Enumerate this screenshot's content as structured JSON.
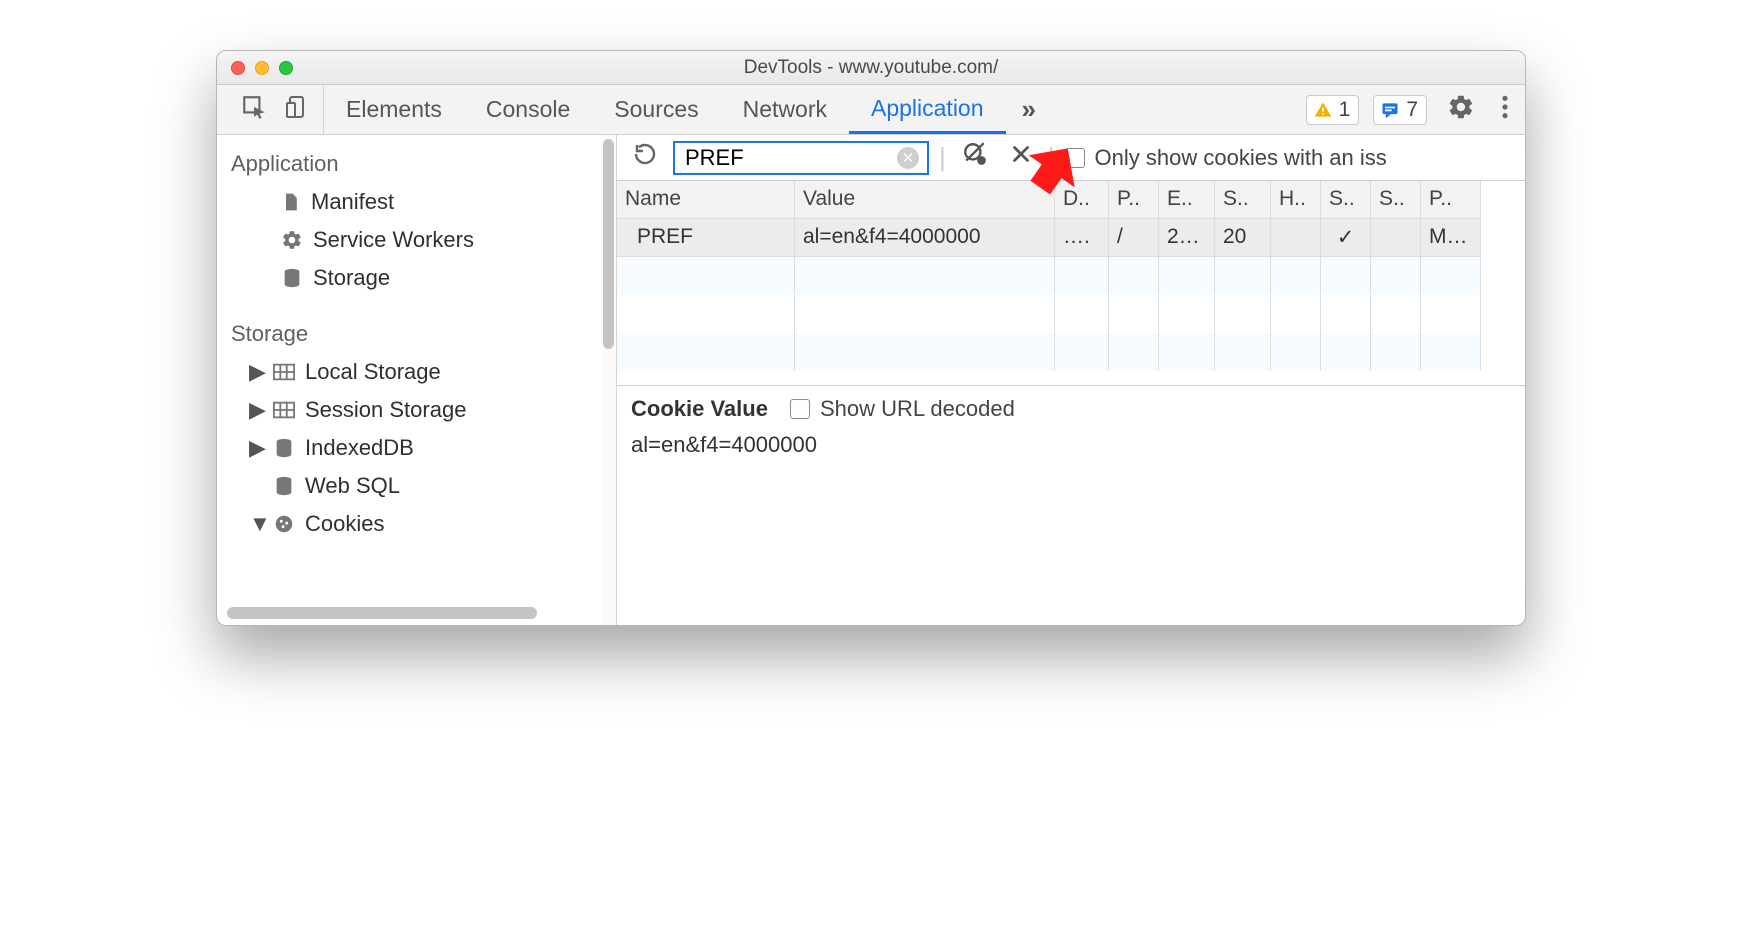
{
  "window": {
    "title": "DevTools - www.youtube.com/"
  },
  "tabs": {
    "items": [
      "Elements",
      "Console",
      "Sources",
      "Network",
      "Application"
    ],
    "active": "Application"
  },
  "badges": {
    "warnings": "1",
    "messages": "7"
  },
  "sidebar": {
    "application_section": "Application",
    "app_items": {
      "manifest": "Manifest",
      "service_workers": "Service Workers",
      "storage": "Storage"
    },
    "storage_section": "Storage",
    "storage_items": {
      "local_storage": "Local Storage",
      "session_storage": "Session Storage",
      "indexeddb": "IndexedDB",
      "web_sql": "Web SQL",
      "cookies": "Cookies"
    }
  },
  "toolbar": {
    "filter_value": "PREF",
    "only_cookies_label": "Only show cookies with an iss"
  },
  "table": {
    "headers": {
      "name": "Name",
      "value": "Value",
      "d": "D..",
      "p": "P..",
      "e": "E..",
      "s1": "S..",
      "h": "H..",
      "s2": "S..",
      "s3": "S..",
      "p2": "P.."
    },
    "row": {
      "name": "PREF",
      "value": "al=en&f4=4000000",
      "d": "….",
      "p": "/",
      "e": "2…",
      "s": "20",
      "h": "",
      "secure": "✓",
      "samesite": "",
      "priority": "M…"
    }
  },
  "details": {
    "title": "Cookie Value",
    "show_url_label": "Show URL decoded",
    "value": "al=en&f4=4000000"
  }
}
